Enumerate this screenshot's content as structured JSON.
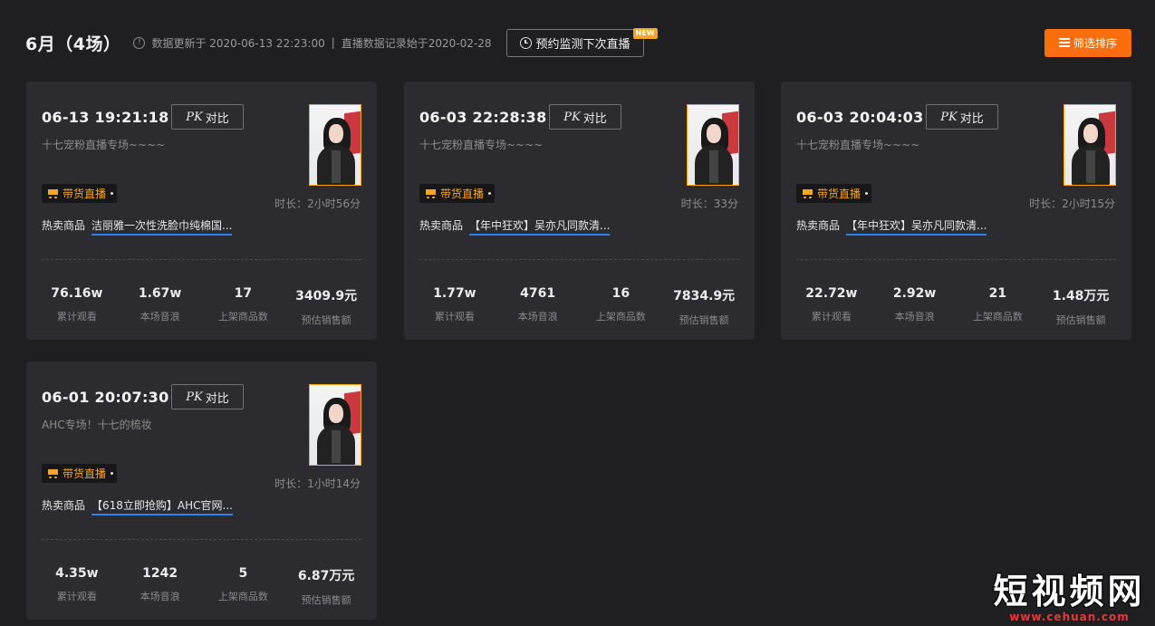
{
  "header": {
    "month_title": "6月（4场）",
    "info_icon": "info-icon",
    "update_text": "数据更新于 2020-06-13 22:23:00",
    "separator": "|",
    "record_text": "直播数据记录始于2020-02-28",
    "remind_button_label": "预约监测下次直播",
    "new_badge": "NEW",
    "filter_button_label": "筛选排序",
    "accent_color": "#fb6e0e"
  },
  "common": {
    "pk_prefix": "PK",
    "pk_label": "对比",
    "live_tag_label": "带货直播",
    "hot_label": "热卖商品",
    "stat_labels": [
      "累计观看",
      "本场音浪",
      "上架商品数",
      "预估销售额"
    ]
  },
  "sessions": [
    {
      "time": "06-13 19:21:18",
      "title": "十七宠粉直播专场~~~~",
      "duration": "时长：2小时56分",
      "hot_product": "洁丽雅一次性洗脸巾纯棉国...",
      "stats": [
        "76.16w",
        "1.67w",
        "17",
        "3409.9元"
      ]
    },
    {
      "time": "06-03 22:28:38",
      "title": "十七宠粉直播专场~~~~",
      "duration": "时长：33分",
      "hot_product": "【年中狂欢】吴亦凡同款清...",
      "stats": [
        "1.77w",
        "4761",
        "16",
        "7834.9元"
      ]
    },
    {
      "time": "06-03 20:04:03",
      "title": "十七宠粉直播专场~~~~",
      "duration": "时长：2小时15分",
      "hot_product": "【年中狂欢】吴亦凡同款清...",
      "stats": [
        "22.72w",
        "2.92w",
        "21",
        "1.48万元"
      ]
    },
    {
      "time": "06-01 20:07:30",
      "title": "AHC专场！十七的梳妆",
      "duration": "时长：1小时14分",
      "hot_product": "【618立即抢购】AHC官网...",
      "stats": [
        "4.35w",
        "1242",
        "5",
        "6.87万元"
      ]
    }
  ],
  "watermark": {
    "main": "短视频网",
    "url": "www.cehuan.com"
  }
}
